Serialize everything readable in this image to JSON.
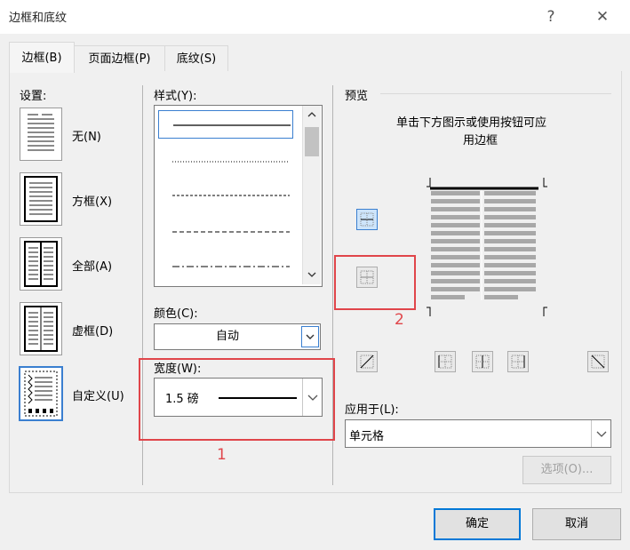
{
  "window": {
    "title": "边框和底纹",
    "help": "?",
    "close": "✕"
  },
  "tabs": [
    {
      "label": "边框(B)"
    },
    {
      "label": "页面边框(P)"
    },
    {
      "label": "底纹(S)"
    }
  ],
  "settings": {
    "title": "设置:",
    "items": [
      {
        "label": "无(N)"
      },
      {
        "label": "方框(X)"
      },
      {
        "label": "全部(A)"
      },
      {
        "label": "虚框(D)"
      },
      {
        "label": "自定义(U)"
      }
    ],
    "selected_index": 4
  },
  "style": {
    "title": "样式(Y):",
    "options": [
      "solid",
      "dotted",
      "dashed-fine",
      "dashed",
      "dash-dot"
    ],
    "selected_index": 0
  },
  "color": {
    "title": "颜色(C):",
    "value": "自动"
  },
  "width": {
    "title": "宽度(W):",
    "value": "1.5 磅"
  },
  "preview": {
    "title": "预览",
    "hint_line1": "单击下方图示或使用按钮可应",
    "hint_line2": "用边框"
  },
  "apply_to": {
    "title": "应用于(L):",
    "value": "单元格"
  },
  "buttons": {
    "options": "选项(O)...",
    "ok": "确定",
    "cancel": "取消"
  },
  "annotations": {
    "box1_number": "1",
    "box2_number": "2",
    "color": "#e0454a"
  }
}
